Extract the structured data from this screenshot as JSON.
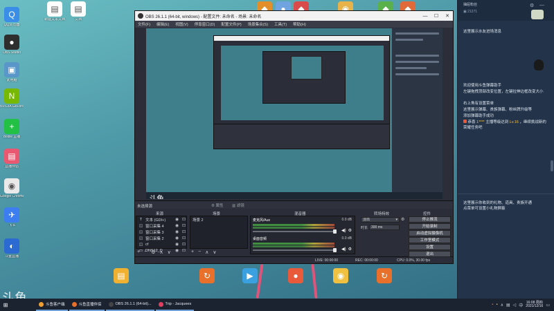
{
  "desktop_icons_left": [
    {
      "label": "QQ浏览器",
      "color": "#3b8ee8",
      "glyph": "Q"
    },
    {
      "label": "OBS Studio",
      "color": "#2e2e2e",
      "glyph": "●"
    },
    {
      "label": "此电脑",
      "color": "#5a97c9",
      "glyph": "▣"
    },
    {
      "label": "NVIDIA GeForce Experience",
      "color": "#76b900",
      "glyph": "N"
    },
    {
      "label": "Bilibili 直播",
      "color": "#22c045",
      "glyph": "+"
    },
    {
      "label": "直播伴侣",
      "color": "#e85870",
      "glyph": "▤"
    },
    {
      "label": "Google Chrome",
      "color": "#e9e9e9",
      "glyph": "◉"
    },
    {
      "label": "飞书",
      "color": "#3c7df0",
      "glyph": "✈"
    },
    {
      "label": "斗鱼直播",
      "color": "#2b6bd1",
      "glyph": "◐"
    }
  ],
  "desktop_icons_top": [
    {
      "label": "新建文本文档",
      "color": "#ffffff",
      "glyph": "▤"
    },
    {
      "label": "文档",
      "color": "#ffffff",
      "glyph": "▤"
    },
    {
      "label": "",
      "color": "#e28f2a",
      "glyph": "◆"
    },
    {
      "label": "",
      "color": "#6fa4e0",
      "glyph": "●"
    },
    {
      "label": "",
      "color": "#d94a4a",
      "glyph": "◆"
    },
    {
      "label": "",
      "color": "#e8b24a",
      "glyph": "◉"
    },
    {
      "label": "",
      "color": "#5ab04a",
      "glyph": "◆"
    },
    {
      "label": "",
      "color": "#e06a3a",
      "glyph": "◆"
    }
  ],
  "desktop_icons_bottom": [
    {
      "label": "",
      "color": "#f0b030",
      "glyph": "▤"
    },
    {
      "label": "",
      "color": "#e8702a",
      "glyph": "↻"
    },
    {
      "label": "",
      "color": "#3aa0e0",
      "glyph": "▶"
    },
    {
      "label": "",
      "color": "#e85a3a",
      "glyph": "●"
    },
    {
      "label": "",
      "color": "#f0c040",
      "glyph": "◉"
    },
    {
      "label": "",
      "color": "#e8702a",
      "glyph": "↻"
    }
  ],
  "obs": {
    "window_title": "OBS 26.1.1 (64-bit, windows) - 配置文件: 未命名 - 场景: 未命名",
    "menu": [
      "文件(F)",
      "编辑(E)",
      "视图(V)",
      "停靠窗口(D)",
      "配置文件(P)",
      "场景集合(S)",
      "工具(T)",
      "帮助(H)"
    ],
    "window_buttons": [
      "—",
      "☐",
      "✕"
    ],
    "preview_watermark": "斗鱼",
    "no_source_selected": "未选择源",
    "properties_label": "属性",
    "filters_label": "滤镜",
    "dock_headers": {
      "sources": "来源",
      "scenes": "场景",
      "mixer": "混音器",
      "transitions": "转场特效",
      "controls": "控件"
    },
    "sources": [
      {
        "icon": "T",
        "name": "文本 (GDI+)"
      },
      {
        "icon": "◫",
        "name": "窗口采集 4"
      },
      {
        "icon": "◫",
        "name": "窗口采集 3"
      },
      {
        "icon": "◫",
        "name": "窗口采集 2"
      },
      {
        "icon": "◫",
        "name": "cf"
      },
      {
        "icon": "▭",
        "name": "DNS12_D"
      }
    ],
    "scenes": [
      "场景 2"
    ],
    "mixer": [
      {
        "name": "麦克风/Aux",
        "db": "0.0 dB"
      },
      {
        "name": "桌面音频",
        "db": "0.0 dB"
      }
    ],
    "transition": {
      "type": "淡出",
      "duration_label": "时长",
      "duration": "300 ms"
    },
    "controls": [
      "停止推流",
      "开始录制",
      "启动虚拟摄像机",
      "工作室模式",
      "设置",
      "退出"
    ],
    "status": {
      "live": "LIVE: 00:00:00",
      "rec": "REC: 00:00:00",
      "cpu": "CPU: 0.0%, 30.00 fps"
    }
  },
  "chat": {
    "header_name": "抽屉粉丝",
    "header_count": "21271",
    "messages": [
      {
        "text": "这里展示水友进场消息"
      },
      {
        "text": "欢迎使用斗鱼弹幕助手"
      },
      {
        "text": "左键拖拽顶部改变位置，左键拉伸边框改变大小"
      },
      {
        "text": "右上角有设置菜单"
      },
      {
        "text": "这里展示弹幕、贵族弹幕、粉丝牌升级等"
      },
      {
        "text": "添加弹幕助手成功"
      }
    ],
    "system_notice": {
      "prefix": "恭喜",
      "user": "1**** ",
      "middle": "主播等级达到",
      "level": "Lv.16",
      "suffix": "，继续挑战新的荣耀任务吧"
    },
    "gift_area_text": "这里展示你收到的礼物、道具、贵族开通\n点菜单可设置小礼物屏蔽"
  },
  "taskbar": {
    "items": [
      {
        "label": "斗鱼客户端",
        "color": "#f0a030"
      },
      {
        "label": "斗鱼直播伴侣",
        "color": "#e8702a"
      },
      {
        "label": "OBS 26.1.1 (64-bit)...",
        "color": "#444444"
      },
      {
        "label": "Trip - Jacquees",
        "color": "#e04060"
      }
    ],
    "time": "16:08 周四",
    "date": "2021/12/16"
  },
  "watermark": "斗鱼"
}
